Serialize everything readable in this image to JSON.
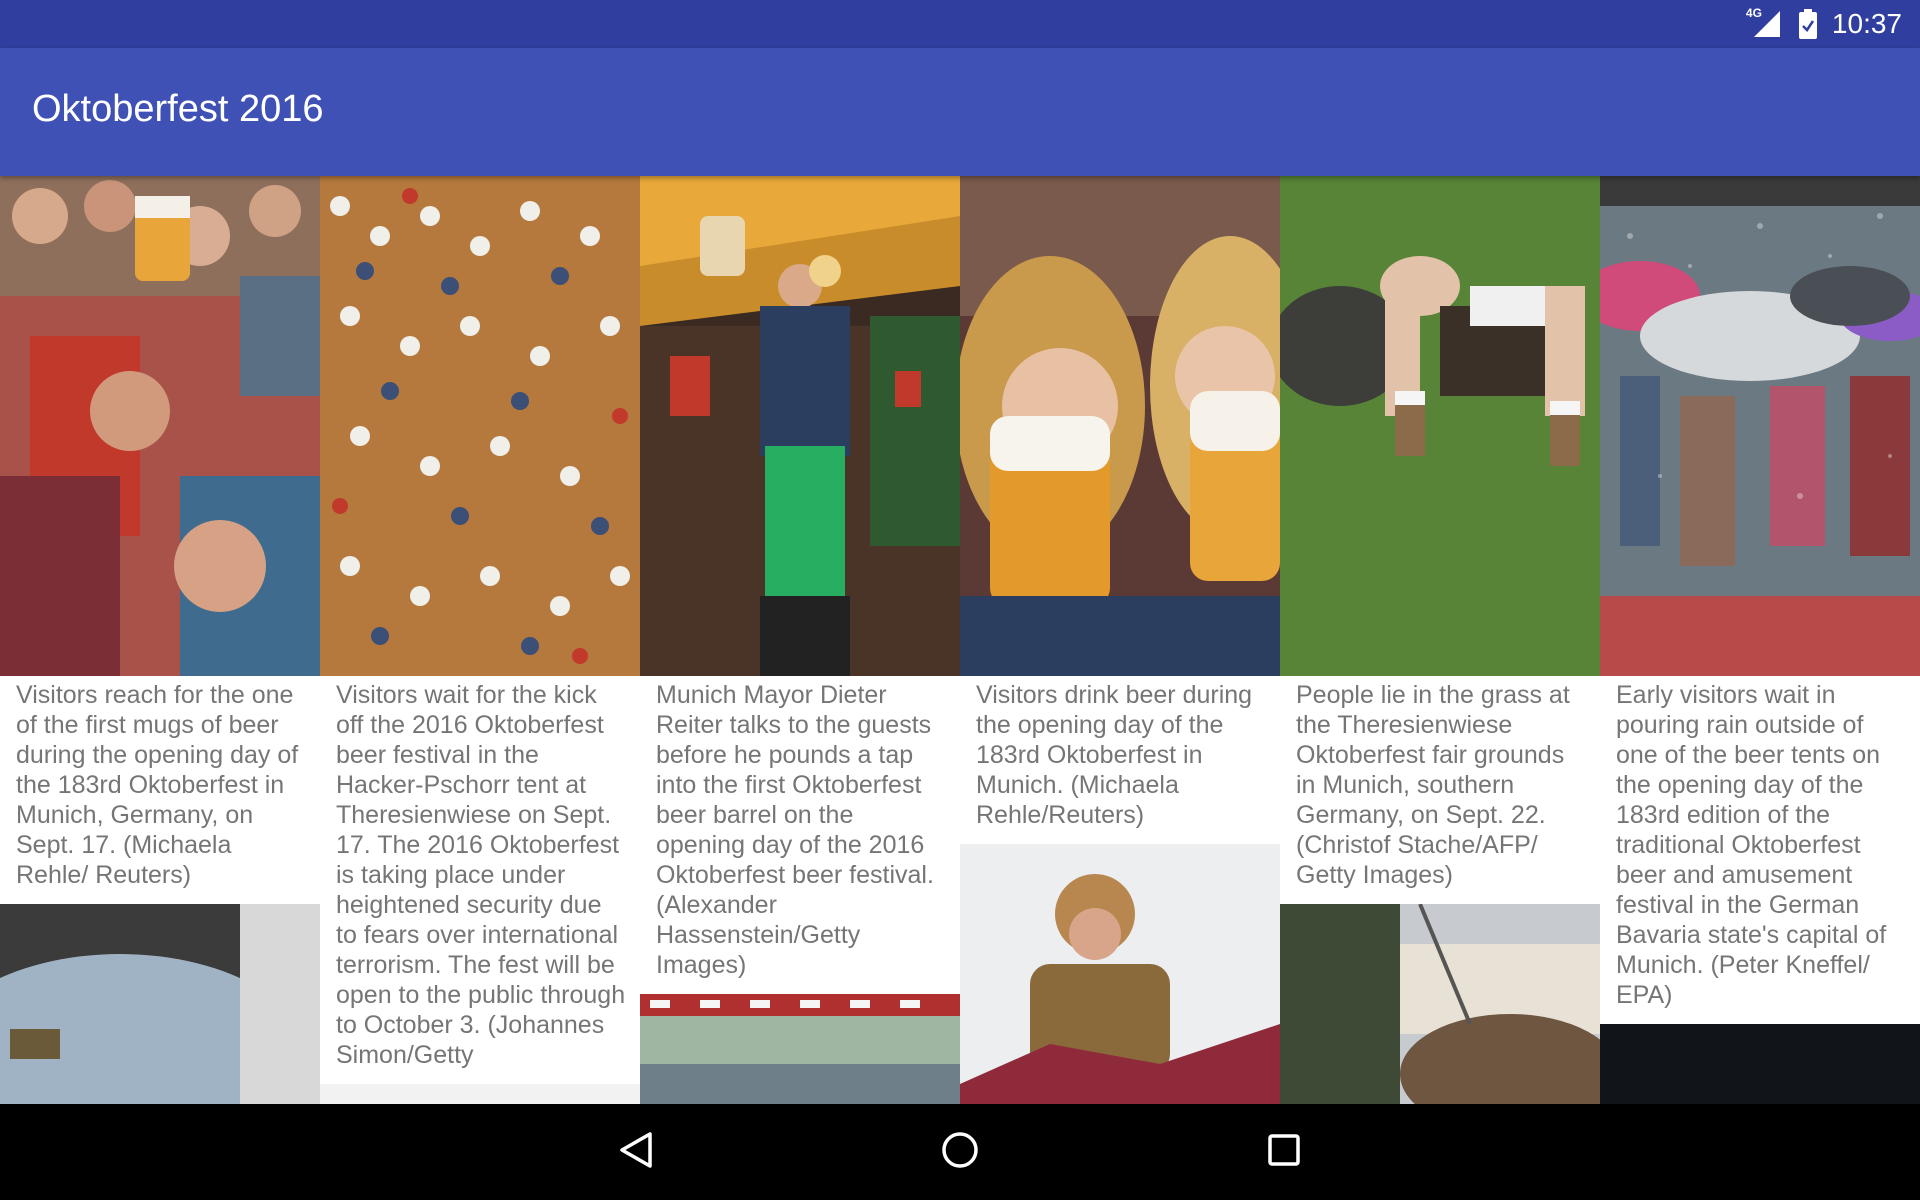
{
  "status_bar": {
    "network": "4G",
    "time": "10:37"
  },
  "app_bar": {
    "title": "Oktoberfest 2016"
  },
  "gallery": [
    {
      "caption": "Visitors reach for the one of the first mugs of beer during the opening day of the 183rd Oktoberfest in Munich, Germany, on Sept. 17. (Michaela Rehle/ Reuters)"
    },
    {
      "caption": "Visitors wait for the kick off the 2016 Oktoberfest beer festival in the Hacker-Pschorr tent at Theresienwiese on Sept. 17. The 2016 Oktoberfest is taking place under heightened security due to fears over international terrorism. The fest will be open to the public through to October 3. (Johannes Simon/Getty"
    },
    {
      "caption": "Munich Mayor Dieter Reiter talks to the guests before he pounds a tap into the first Oktoberfest beer barrel on the opening day of the 2016 Oktoberfest beer festival. (Alexander Hassenstein/Getty Images)"
    },
    {
      "caption": "Visitors drink beer during the opening day of the 183rd Oktoberfest in Munich. (Michaela Rehle/Reuters)"
    },
    {
      "caption": "People lie in the grass at the Theresienwiese Oktoberfest fair grounds in Munich, southern Germany, on Sept. 22. (Christof Stache/AFP/ Getty Images)"
    },
    {
      "caption": "Early visitors wait in pouring rain outside of one of the beer tents on the opening day of the 183rd edition of the traditional Oktoberfest beer and amusement festival in the German Bavaria state's capital of Munich. (Peter Kneffel/ EPA)"
    }
  ],
  "nav": {
    "back_icon": "back-triangle-icon",
    "home_icon": "home-circle-icon",
    "recents_icon": "recents-square-icon"
  },
  "colors": {
    "status_bar": "#303F9F",
    "app_bar": "#3F51B5",
    "caption_text": "#757575",
    "nav_bar": "#000000"
  }
}
